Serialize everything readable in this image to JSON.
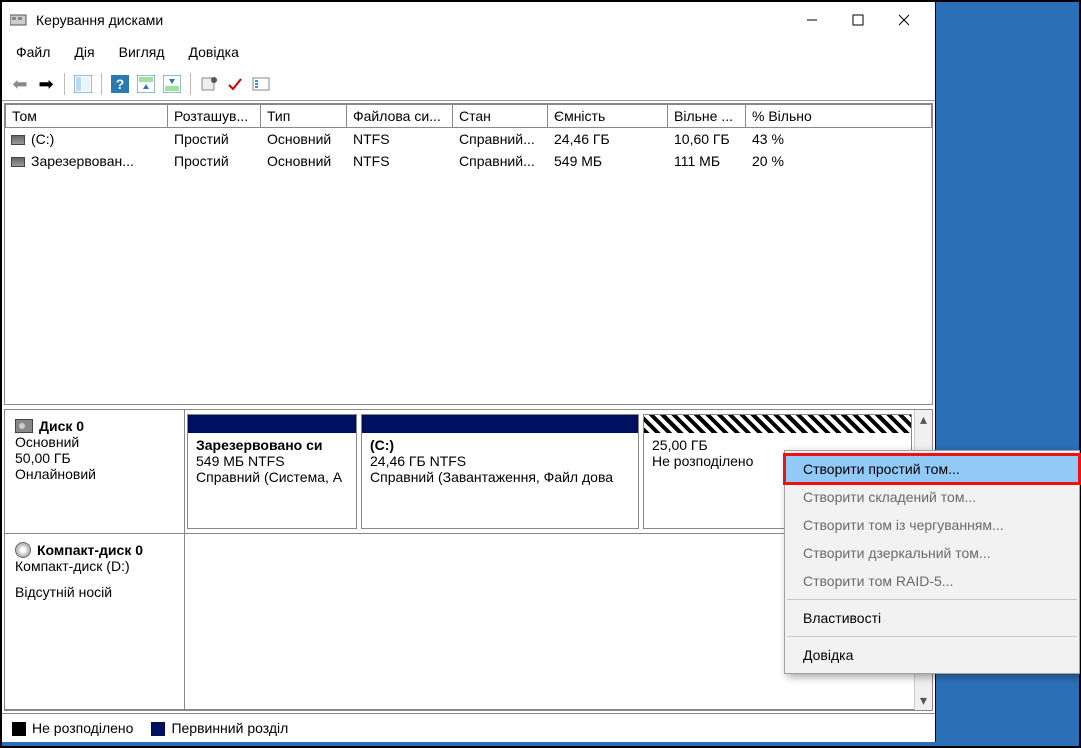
{
  "window": {
    "title": "Керування дисками"
  },
  "menu": {
    "file": "Файл",
    "action": "Дія",
    "view": "Вигляд",
    "help": "Довідка"
  },
  "columns": {
    "volume": "Том",
    "layout": "Розташув...",
    "type": "Тип",
    "fs": "Файлова си...",
    "status": "Стан",
    "capacity": "Ємність",
    "free": "Вільне ...",
    "pct": "% Вільно"
  },
  "rows": [
    {
      "volume": "(C:)",
      "layout": "Простий",
      "type": "Основний",
      "fs": "NTFS",
      "status": "Справний...",
      "capacity": "24,46 ГБ",
      "free": "10,60 ГБ",
      "pct": "43 %"
    },
    {
      "volume": "Зарезервован...",
      "layout": "Простий",
      "type": "Основний",
      "fs": "NTFS",
      "status": "Справний...",
      "capacity": "549 МБ",
      "free": "111 МБ",
      "pct": "20 %"
    }
  ],
  "disk0": {
    "name": "Диск 0",
    "type": "Основний",
    "size": "50,00 ГБ",
    "state": "Онлайновий",
    "p1": {
      "name": "Зарезервовано си",
      "info": "549 МБ NTFS",
      "stat": "Справний (Система, А"
    },
    "p2": {
      "name": "(C:)",
      "info": "24,46 ГБ NTFS",
      "stat": "Справний (Завантаження, Файл дова"
    },
    "p3": {
      "name": "",
      "info": "25,00 ГБ",
      "stat": "Не розподілено"
    }
  },
  "cd0": {
    "name": "Компакт-диск 0",
    "drive": "Компакт-диск (D:)",
    "state": "Відсутній носій"
  },
  "legend": {
    "unalloc": "Не розподілено",
    "primary": "Первинний розділ"
  },
  "ctx": {
    "simple": "Створити простий том...",
    "spanned": "Створити складений том...",
    "striped": "Створити том із чергуванням...",
    "mirror": "Створити дзеркальний том...",
    "raid5": "Створити том RAID-5...",
    "props": "Властивості",
    "help": "Довідка"
  }
}
